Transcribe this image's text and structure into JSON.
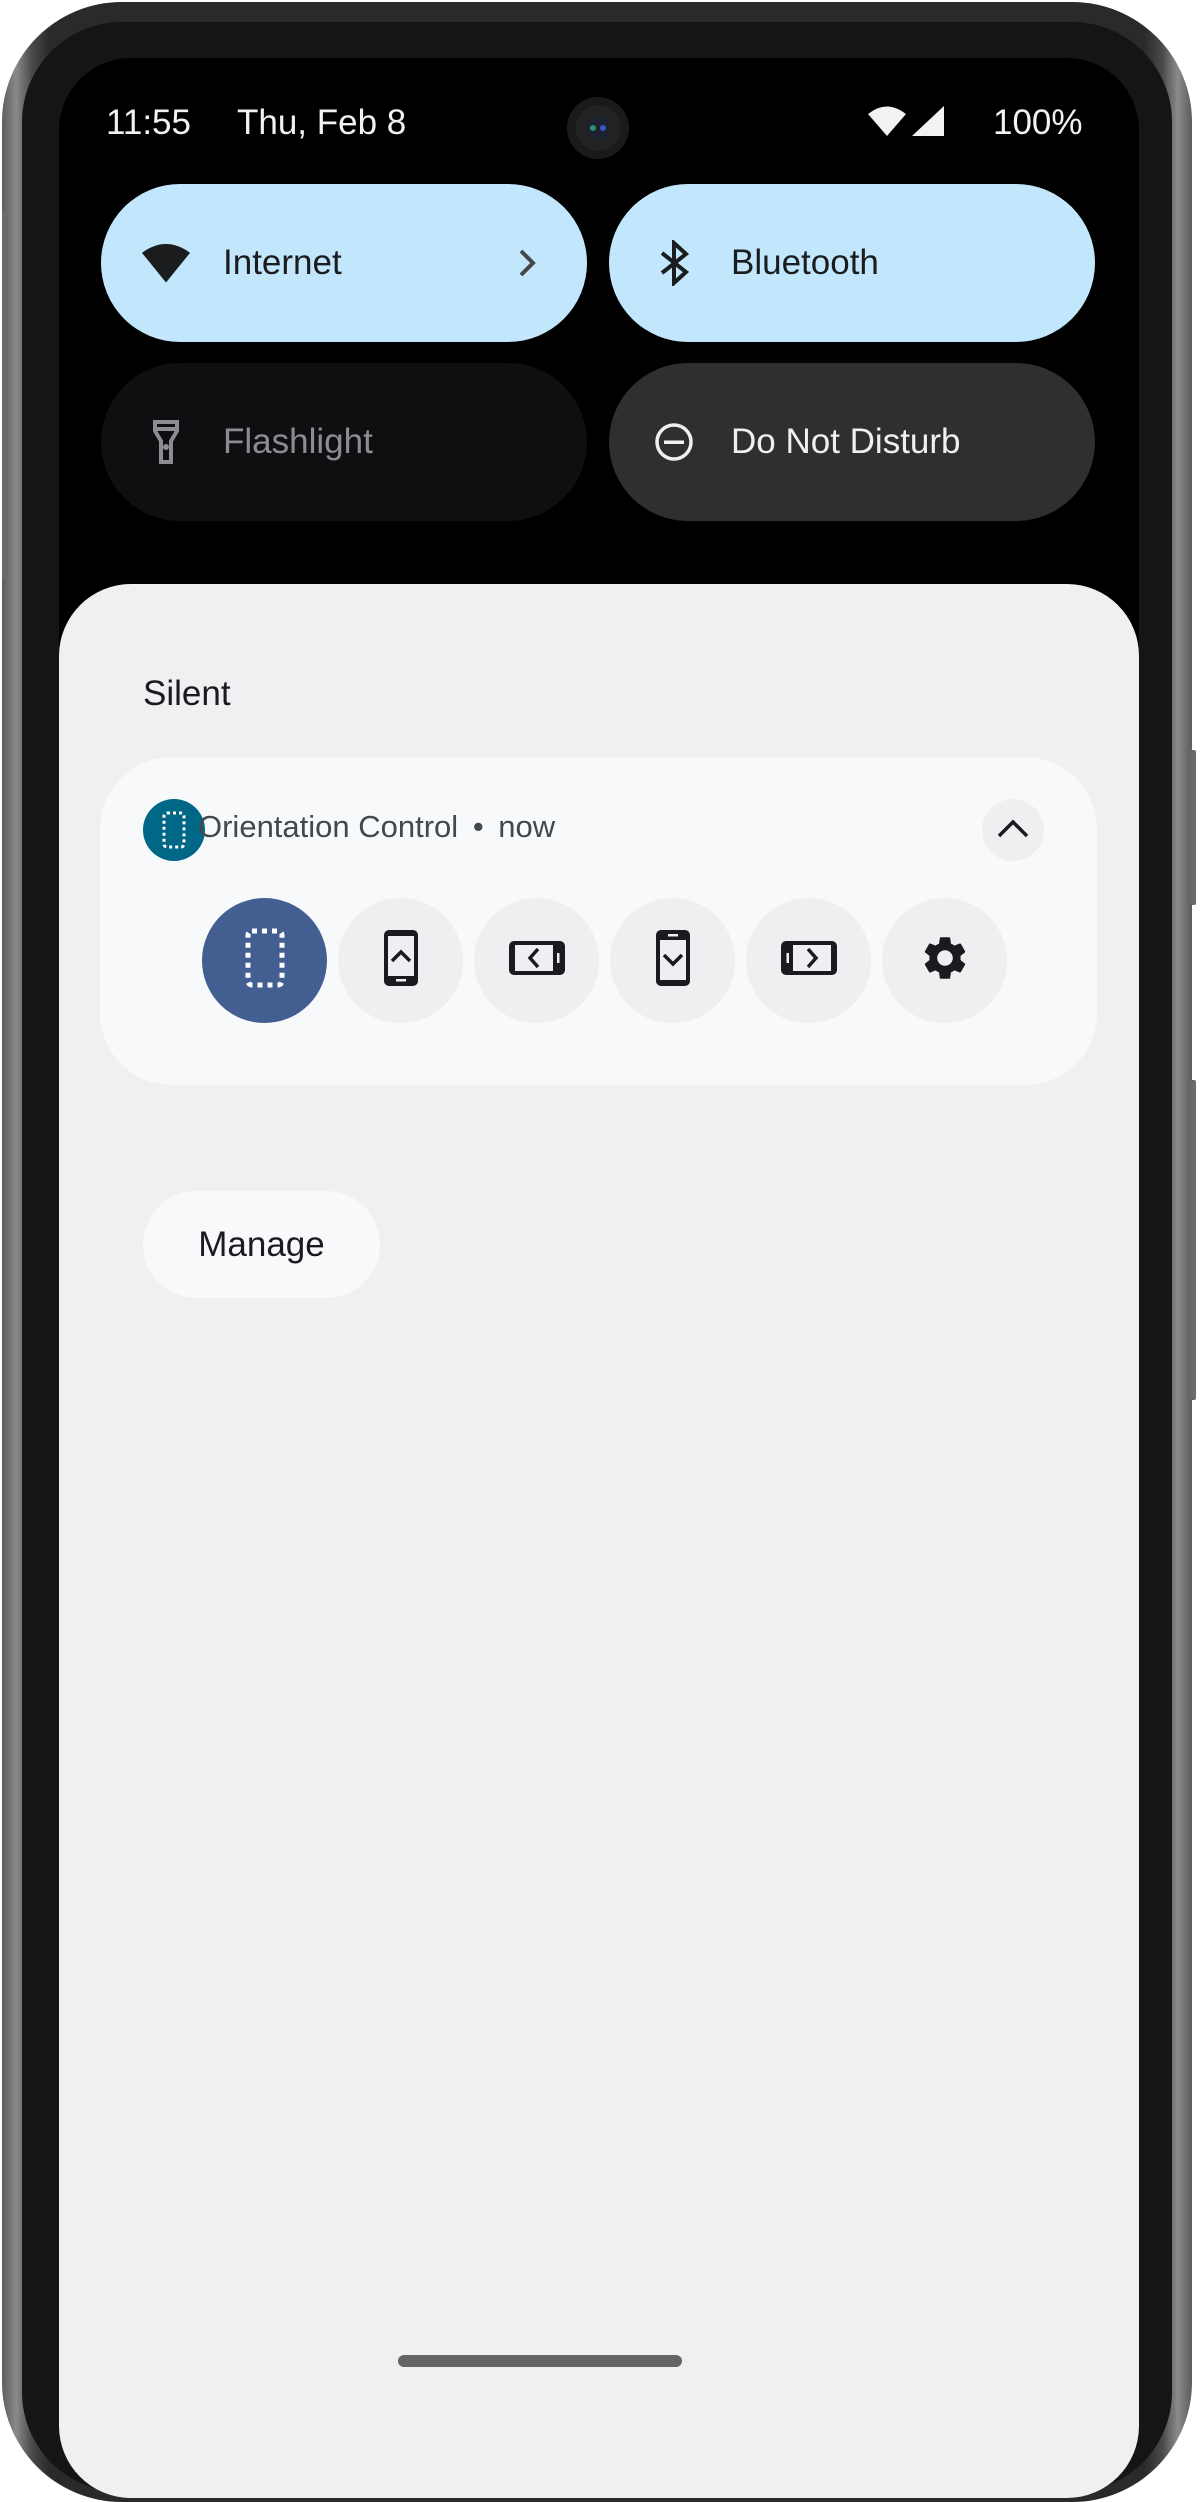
{
  "status_bar": {
    "time": "11:55",
    "date": "Thu, Feb 8",
    "icons": [
      "wifi-icon",
      "cellular-signal-icon"
    ],
    "battery": "100%"
  },
  "quick_settings": {
    "tiles": [
      {
        "label": "Internet",
        "icon": "wifi-icon",
        "state": "on",
        "has_chevron": true
      },
      {
        "label": "Bluetooth",
        "icon": "bluetooth-icon",
        "state": "on",
        "has_chevron": false
      },
      {
        "label": "Flashlight",
        "icon": "flashlight-icon",
        "state": "unavailable",
        "has_chevron": false
      },
      {
        "label": "Do Not Disturb",
        "icon": "do-not-disturb-icon",
        "state": "off",
        "has_chevron": false
      }
    ],
    "colors": {
      "tile_on": "#c2e7fd",
      "tile_off": "#2e2f31",
      "tile_unavailable": "#0e0f10"
    }
  },
  "notifications": {
    "section_title": "Silent",
    "items": [
      {
        "app_name": "Orientation Control",
        "separator": "•",
        "time": "now",
        "app_icon": "auto-rotate-icon",
        "app_icon_color": "#006786",
        "expanded": true,
        "actions": [
          {
            "name": "auto-rotate",
            "icon": "auto-rotate-icon",
            "selected": true
          },
          {
            "name": "portrait",
            "icon": "portrait-icon",
            "selected": false
          },
          {
            "name": "landscape",
            "icon": "landscape-icon",
            "selected": false
          },
          {
            "name": "reverse-portrait",
            "icon": "reverse-portrait-icon",
            "selected": false
          },
          {
            "name": "reverse-landscape",
            "icon": "reverse-landscape-icon",
            "selected": false
          },
          {
            "name": "settings",
            "icon": "gear-icon",
            "selected": false
          }
        ],
        "selected_color": "#435e91"
      }
    ],
    "manage_label": "Manage"
  }
}
